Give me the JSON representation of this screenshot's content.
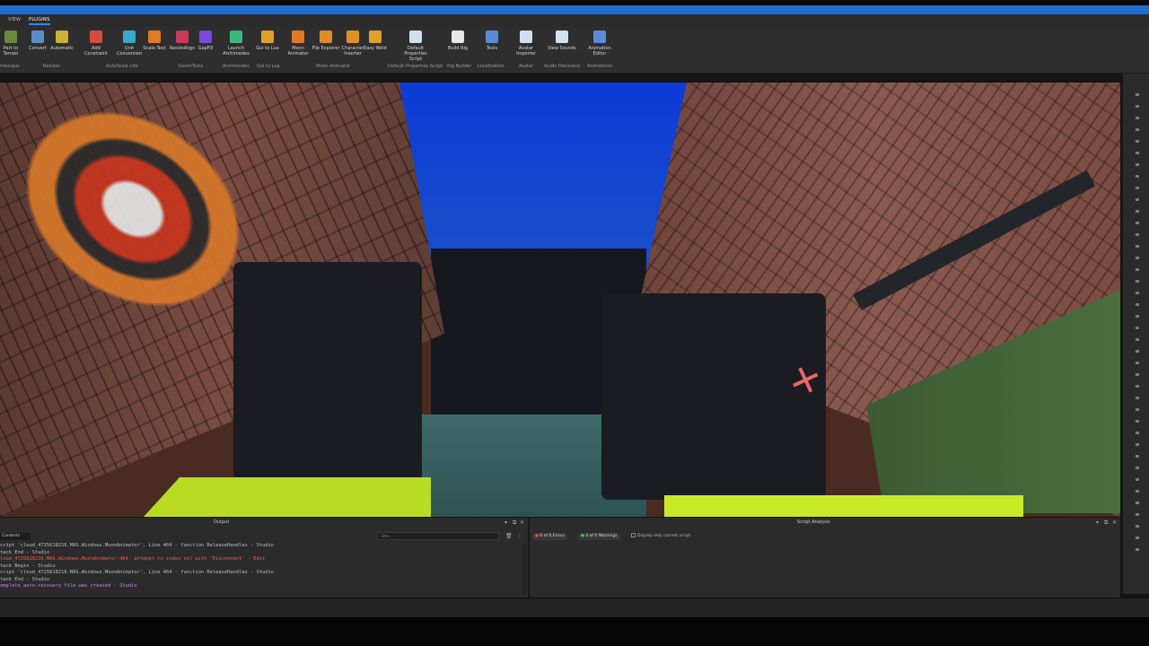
{
  "tabs": [
    {
      "label": "VIEW",
      "active": false
    },
    {
      "label": "PLUGINS",
      "active": true
    }
  ],
  "ribbon": {
    "buttons": [
      {
        "label": "Part to Terrain",
        "color": "#6a8a3a"
      },
      {
        "label": "Convert",
        "color": "#5b8cc8"
      },
      {
        "label": "Automatic",
        "color": "#c8b23a"
      },
      {
        "label": "Add Constraint",
        "color": "#d84a3a"
      },
      {
        "label": "Unit Conversion",
        "color": "#3aa8c8"
      },
      {
        "label": "Scale Text",
        "color": "#e07a2a"
      },
      {
        "label": "ResizeAlign",
        "color": "#c83a5a"
      },
      {
        "label": "GapFill",
        "color": "#7a4ad8"
      },
      {
        "label": "Launch Archimedes",
        "color": "#3ab87a"
      },
      {
        "label": "Gui to Lua",
        "color": "#e0a02a"
      },
      {
        "label": "Moon Animator",
        "color": "#e07a2a"
      },
      {
        "label": "File Explorer",
        "color": "#e08a2a"
      },
      {
        "label": "Character Inserter",
        "color": "#e0902a"
      },
      {
        "label": "Easy Weld",
        "color": "#e0a02a"
      },
      {
        "label": "Default Properties Script",
        "color": "#cfe0f0"
      },
      {
        "label": "Build Rig",
        "color": "#e8e8e8"
      },
      {
        "label": "Tools",
        "color": "#5a8ad8"
      },
      {
        "label": "Avatar Importer",
        "color": "#cfe0f0"
      },
      {
        "label": "View Sounds",
        "color": "#cfe0f0"
      },
      {
        "label": "Animation Editor",
        "color": "#5a8ad8"
      }
    ],
    "groups": [
      "mkargus",
      "Reclass",
      "AutoScale Lite",
      "GeomTools",
      "Archimedes",
      "Gui to Lua",
      "Moon Animator",
      "Default Properties Script",
      "Rig Builder",
      "Localization",
      "Avatar",
      "Audio Discovery",
      "Animations"
    ]
  },
  "output": {
    "title": "Output",
    "contents_label": "Contents",
    "filter_placeholder": "Filter...",
    "lines": [
      {
        "text": "cript 'cloud_4725618216.MAS.Windows.MoonAnimator', Line 464 - function ReleaseHandles  -  Studio",
        "color": "#bfbfbf"
      },
      {
        "text": "tack End  -  Studio",
        "color": "#bfbfbf"
      },
      {
        "text": "loud_4725618216.MAS.Windows.MoonAnimator:464: attempt to index nil with 'Disconnect'  -  Edit",
        "color": "#ff5a4a"
      },
      {
        "text": "tack Begin  -  Studio",
        "color": "#bfbfbf"
      },
      {
        "text": "cript 'cloud_4725618216.MAS.Windows.MoonAnimator', Line 464 - function ReleaseHandles  -  Studio",
        "color": "#bfbfbf"
      },
      {
        "text": "tack End  -  Studio",
        "color": "#bfbfbf"
      },
      {
        "text": "omplete auto-recovery file was created  -  Studio",
        "color": "#c88ae8"
      }
    ]
  },
  "script_analysis": {
    "title": "Script Analysis",
    "errors": "0 of 0 Errors",
    "warnings": "0 of 0 Warnings",
    "checkbox_label": "Display only current script"
  },
  "colors": {
    "accent": "#1f6fd1",
    "ribbon_bg": "#2e2e2e",
    "panel_bg": "#2b2b2b"
  }
}
